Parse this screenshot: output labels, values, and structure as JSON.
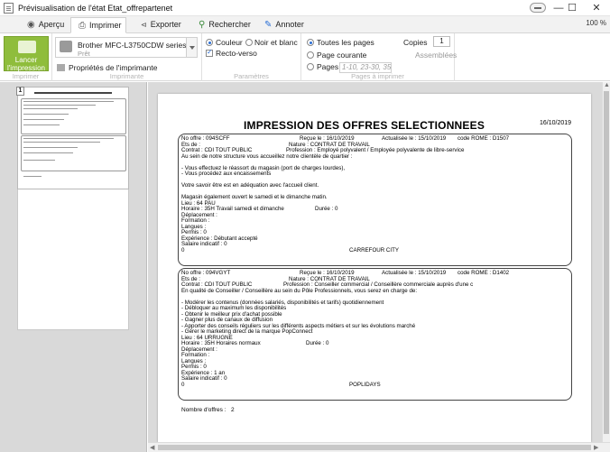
{
  "window": {
    "title": "Prévisualisation de l'état Etat_offrepartenet"
  },
  "tabs": [
    {
      "label": "Aperçu",
      "icon": "eye-icon"
    },
    {
      "label": "Imprimer",
      "icon": "printer-icon",
      "active": true
    },
    {
      "label": "Exporter",
      "icon": "share-icon"
    },
    {
      "label": "Rechercher",
      "icon": "search-icon"
    },
    {
      "label": "Annoter",
      "icon": "pencil-icon"
    }
  ],
  "zoom": "100 %",
  "ribbon": {
    "launch_label_1": "Lancer",
    "launch_label_2": "l'impression",
    "printer_name": "Brother MFC-L3750CDW series",
    "printer_status": "Prêt",
    "printer_properties": "Propriétés de l'imprimante",
    "color_label": "Couleur",
    "bw_label": "Noir et blanc",
    "duplex_label": "Recto-verso",
    "all_pages_label": "Toutes les pages",
    "current_page_label": "Page courante",
    "pages_label": "Pages",
    "pages_placeholder": "1-10, 23-30, 35",
    "copies_label": "Copies",
    "copies_value": "1",
    "collated_label": "Assemblées",
    "group_print": "Imprimer",
    "group_printer": "Imprimante",
    "group_params": "Paramètres",
    "group_pages": "Pages à imprimer"
  },
  "thumbnail": {
    "page_number": "1"
  },
  "document": {
    "title": "IMPRESSION DES OFFRES SELECTIONNEES",
    "date": "16/10/2019",
    "records": [
      {
        "lines": [
          [
            "No offre : 094SCFF",
            "Reçue le : 16/10/2019",
            "Actualisée le : 15/10/2019",
            "code ROME : D1507"
          ],
          [
            "Ets de :",
            "Nature : CONTRAT DE TRAVAIL"
          ],
          [
            "Contrat : CDI TOUT PUBLIC",
            "Profession : Employé polyvalent / Employée polyvalente de libre-service"
          ],
          [
            "Au sein de notre structure vous accueillez notre clientèle de quartier :"
          ],
          [
            ""
          ],
          [
            "- Vous effectuez le réassort du magasin (port de charges lourdes),"
          ],
          [
            "- Vous procédez aux encaissements"
          ],
          [
            ""
          ],
          [
            "Votre savoir être est en adéquation avec l'accueil client."
          ],
          [
            ""
          ],
          [
            "Magasin également ouvert le samedi et le dimanche matin."
          ],
          [
            "Lieu : 64 PAU"
          ],
          [
            "Horaire : 35H Travail samedi et dimanche",
            "Durée : 0"
          ],
          [
            "Déplacement :"
          ],
          [
            "Formation :"
          ],
          [
            "Langues :"
          ],
          [
            "Permis : 0"
          ],
          [
            "Expérience : Débutant accepté"
          ],
          [
            "Salaire indicatif : 0"
          ],
          [
            "0",
            "CARREFOUR CITY"
          ]
        ]
      },
      {
        "lines": [
          [
            "No offre : 094VGYT",
            "Reçue le : 16/10/2019",
            "Actualisée le : 15/10/2019",
            "code ROME : D1402"
          ],
          [
            "Ets de :",
            "Nature : CONTRAT DE TRAVAIL"
          ],
          [
            "Contrat : CDI TOUT PUBLIC",
            "Profession : Conseiller commercial / Conseillère commerciale auprès d'une c"
          ],
          [
            "En qualité de Conseiller / Conseillère au sein du Pôle Professionnels, vous serez en charge de:"
          ],
          [
            ""
          ],
          [
            "- Modérer les contenus (données salariés, disponibilités et tarifs) quotidiennement"
          ],
          [
            "- Débloquer au maximum les disponibilités"
          ],
          [
            "- Obtenir le meilleur prix d'achat possible"
          ],
          [
            "- Gagner plus de canaux de diffusion"
          ],
          [
            "- Apporter des conseils réguliers sur les différents aspects métiers et sur les évolutions marché"
          ],
          [
            "- Gérer le marketing direct de la marque PopConnect"
          ],
          [
            "Lieu : 64 URRUGNE"
          ],
          [
            "Horaire : 35H Horaires normaux",
            "Durée : 0"
          ],
          [
            "Déplacement :"
          ],
          [
            "Formation :"
          ],
          [
            "Langues :"
          ],
          [
            "Permis : 0"
          ],
          [
            "Expérience : 1 an"
          ],
          [
            "Salaire indicatif : 0"
          ],
          [
            "0",
            "POPLIDAYS"
          ]
        ]
      }
    ],
    "count_label": "Nombre d'offres :",
    "count_value": "2"
  }
}
